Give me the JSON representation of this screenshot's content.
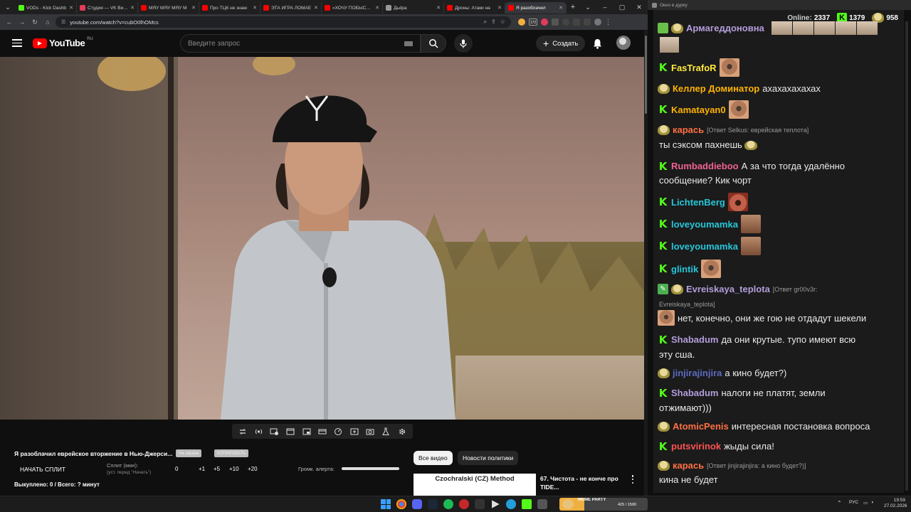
{
  "browser": {
    "tabs": [
      {
        "label": "VODs - Kick Dashb",
        "color": "#53fc18",
        "active": false
      },
      {
        "label": "Студия — VK Виде",
        "color": "#e33b5c",
        "active": false
      },
      {
        "label": "MЯУ MЯУ MЯУ М",
        "color": "#ff0000",
        "active": false
      },
      {
        "label": "Про ТЦК не знаю",
        "color": "#ff0000",
        "active": false
      },
      {
        "label": "ЭТА ИГРА ЛОМАЕ",
        "color": "#ff0000",
        "active": false
      },
      {
        "label": "«ХОЧУ ПОБЫСТРЕ",
        "color": "#ff0000",
        "active": false
      },
      {
        "label": "Дьdра",
        "color": "#999999",
        "active": false
      },
      {
        "label": "Дроны: Атаки на",
        "color": "#ff0000",
        "active": false
      },
      {
        "label": "Я разоблачил",
        "color": "#ff0000",
        "active": true
      }
    ],
    "url": "youtube.com/watch?v=cubO0lhOMcs",
    "ext_badge": "172"
  },
  "youtube": {
    "logo_text": "YouTube",
    "region": "RU",
    "search_placeholder": "Введите запрос",
    "create_label": "Создать"
  },
  "below_video": {
    "video_title": "Я разоблачил еврейское вторжение в Нью-Джерси...",
    "pill1": "На экране",
    "pill2": "КОПИРОВАТЬ",
    "start_split": "НАЧАТЬ СПЛИТ",
    "split_label": "Сплит (мин):",
    "split_hint": "(уст. перед \"Начать\")",
    "split_values": [
      "0",
      "+1",
      "+5",
      "+10",
      "+20"
    ],
    "alert_volume": "Громк. алерта:",
    "alert_volume_level": 1.0,
    "paid_total": "Выкуплено: 0 / Всего: ? минут",
    "chip_all": "Все видео",
    "chip_news": "Новости политики",
    "rec_thumb_text": "Czochralski (CZ) Method",
    "rec_title": "67. Чистота - не конче про TIDE..."
  },
  "chat": {
    "topbar_title": "Окно в дурку",
    "online_label": "Online:",
    "online_count": "2337",
    "kick_count": "1379",
    "frog_count": "958",
    "messages": [
      {
        "user": "Армагеддоновна",
        "color": "#b39ddb",
        "text": ""
      },
      {
        "user": "FasTrafoR",
        "color": "#ffeb3b",
        "text": ""
      },
      {
        "user": "Келлер Доминатор",
        "color": "#ffb300",
        "text": "ахахахахахах"
      },
      {
        "user": "Kamatayan0",
        "color": "#ffb300",
        "text": ""
      },
      {
        "user": "карась",
        "color": "#ff7043",
        "reply": "[Ответ Selkus: еврейская теплота]",
        "text": "ты сэксом пахнешь"
      },
      {
        "user": "Rumbaddieboo",
        "color": "#f06292",
        "text": "А за что тогда удалённо",
        "text2": "сообщение? Кик чорт"
      },
      {
        "user": "LichtenBerg",
        "color": "#26c6da",
        "text": ""
      },
      {
        "user": "loveyoumamka",
        "color": "#26c6da",
        "text": ""
      },
      {
        "user": "loveyoumamka",
        "color": "#26c6da",
        "text": ""
      },
      {
        "user": "glintik",
        "color": "#26c6da",
        "text": ""
      },
      {
        "user": "Evreiskaya_teplota",
        "color": "#b39ddb",
        "reply": "[Ответ gr00v3r:",
        "reply2": "Evreiskaya_teplota]",
        "text": "нет, конечно, они же гою не отдадут шекели"
      },
      {
        "user": "Shabadum",
        "color": "#b39ddb",
        "text": "да они крутые. тупо имеют всю",
        "text2": "эту сша."
      },
      {
        "user": "jinjirajinjira",
        "color": "#5c6bc0",
        "text": "а кино будет?)"
      },
      {
        "user": "Shabadum",
        "color": "#b39ddb",
        "text": "налоги не платят, земли",
        "text2": "отжимают)))"
      },
      {
        "user": "AtomicPenis",
        "color": "#ff7043",
        "text": "интересная постановка вопроса"
      },
      {
        "user": "putsvirinok",
        "color": "#ff5252",
        "text": "жыды сила!"
      },
      {
        "user": "карась",
        "color": "#ff7043",
        "reply": "[Ответ jinjirajinjira: а кино будет?)]",
        "text": "кина не будет"
      }
    ]
  },
  "taskbar": {
    "meme_label": "MEME PARTY",
    "meme_count": "425 / 1500",
    "meme_progress": 0.283,
    "lang": "РУС",
    "time": "19:59",
    "date": "27.02.2026"
  },
  "colors": {
    "kick_green": "#53fc18",
    "yt_red": "#ff0000",
    "chat_bg": "#1b1b1b"
  }
}
